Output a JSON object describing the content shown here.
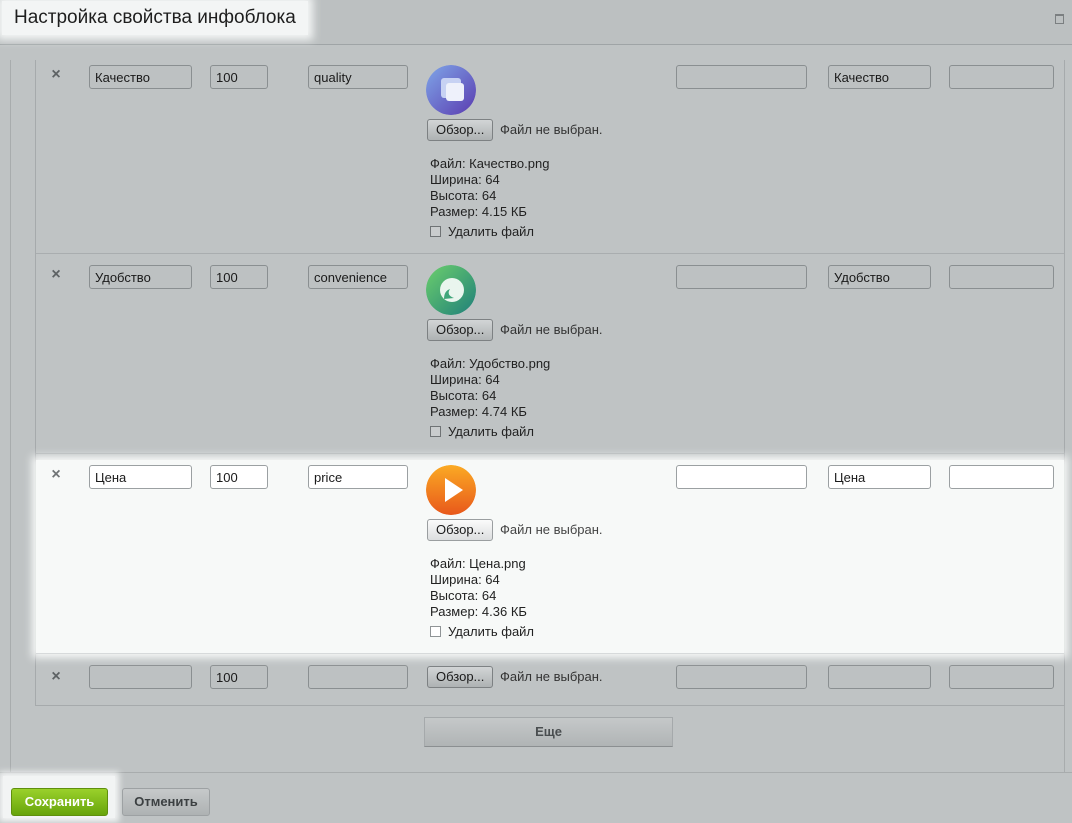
{
  "dialog": {
    "title": "Настройка свойства инфоблока"
  },
  "browse_label": "Обзор...",
  "no_file_text": "Файл не выбран.",
  "delete_file_label": "Удалить файл",
  "rows": [
    {
      "name": "Качество",
      "sort": "100",
      "xml_id": "quality",
      "icon": "quality-icon",
      "icon_colors": [
        "#6c8fd6",
        "#3a4fa8"
      ],
      "extra1": "",
      "extra2": "Качество",
      "extra3": "",
      "file": {
        "file": "Файл: Качество.png",
        "width": "Ширина: 64",
        "height": "Высота: 64",
        "size": "Размер: 4.15 КБ"
      }
    },
    {
      "name": "Удобство",
      "sort": "100",
      "xml_id": "convenience",
      "icon": "convenience-icon",
      "icon_colors": [
        "#5fc08a",
        "#2e8a6a"
      ],
      "extra1": "",
      "extra2": "Удобство",
      "extra3": "",
      "file": {
        "file": "Файл: Удобство.png",
        "width": "Ширина: 64",
        "height": "Высота: 64",
        "size": "Размер: 4.74 КБ"
      }
    },
    {
      "name": "Цена",
      "sort": "100",
      "xml_id": "price",
      "icon": "price-play-icon",
      "icon_colors": [
        "#f79a1e",
        "#e0621a"
      ],
      "extra1": "",
      "extra2": "Цена",
      "extra3": "",
      "file": {
        "file": "Файл: Цена.png",
        "width": "Ширина: 64",
        "height": "Высота: 64",
        "size": "Размер: 4.36 КБ"
      }
    },
    {
      "name": "",
      "sort": "100",
      "xml_id": "",
      "extra1": "",
      "extra2": "",
      "extra3": ""
    }
  ],
  "more_button": "Еще",
  "footer": {
    "save": "Сохранить",
    "cancel": "Отменить"
  },
  "colors": {
    "save_green": "#7ab818",
    "overlay_gray": "#bfc3c4",
    "highlight_white": "#f7f9f8"
  }
}
